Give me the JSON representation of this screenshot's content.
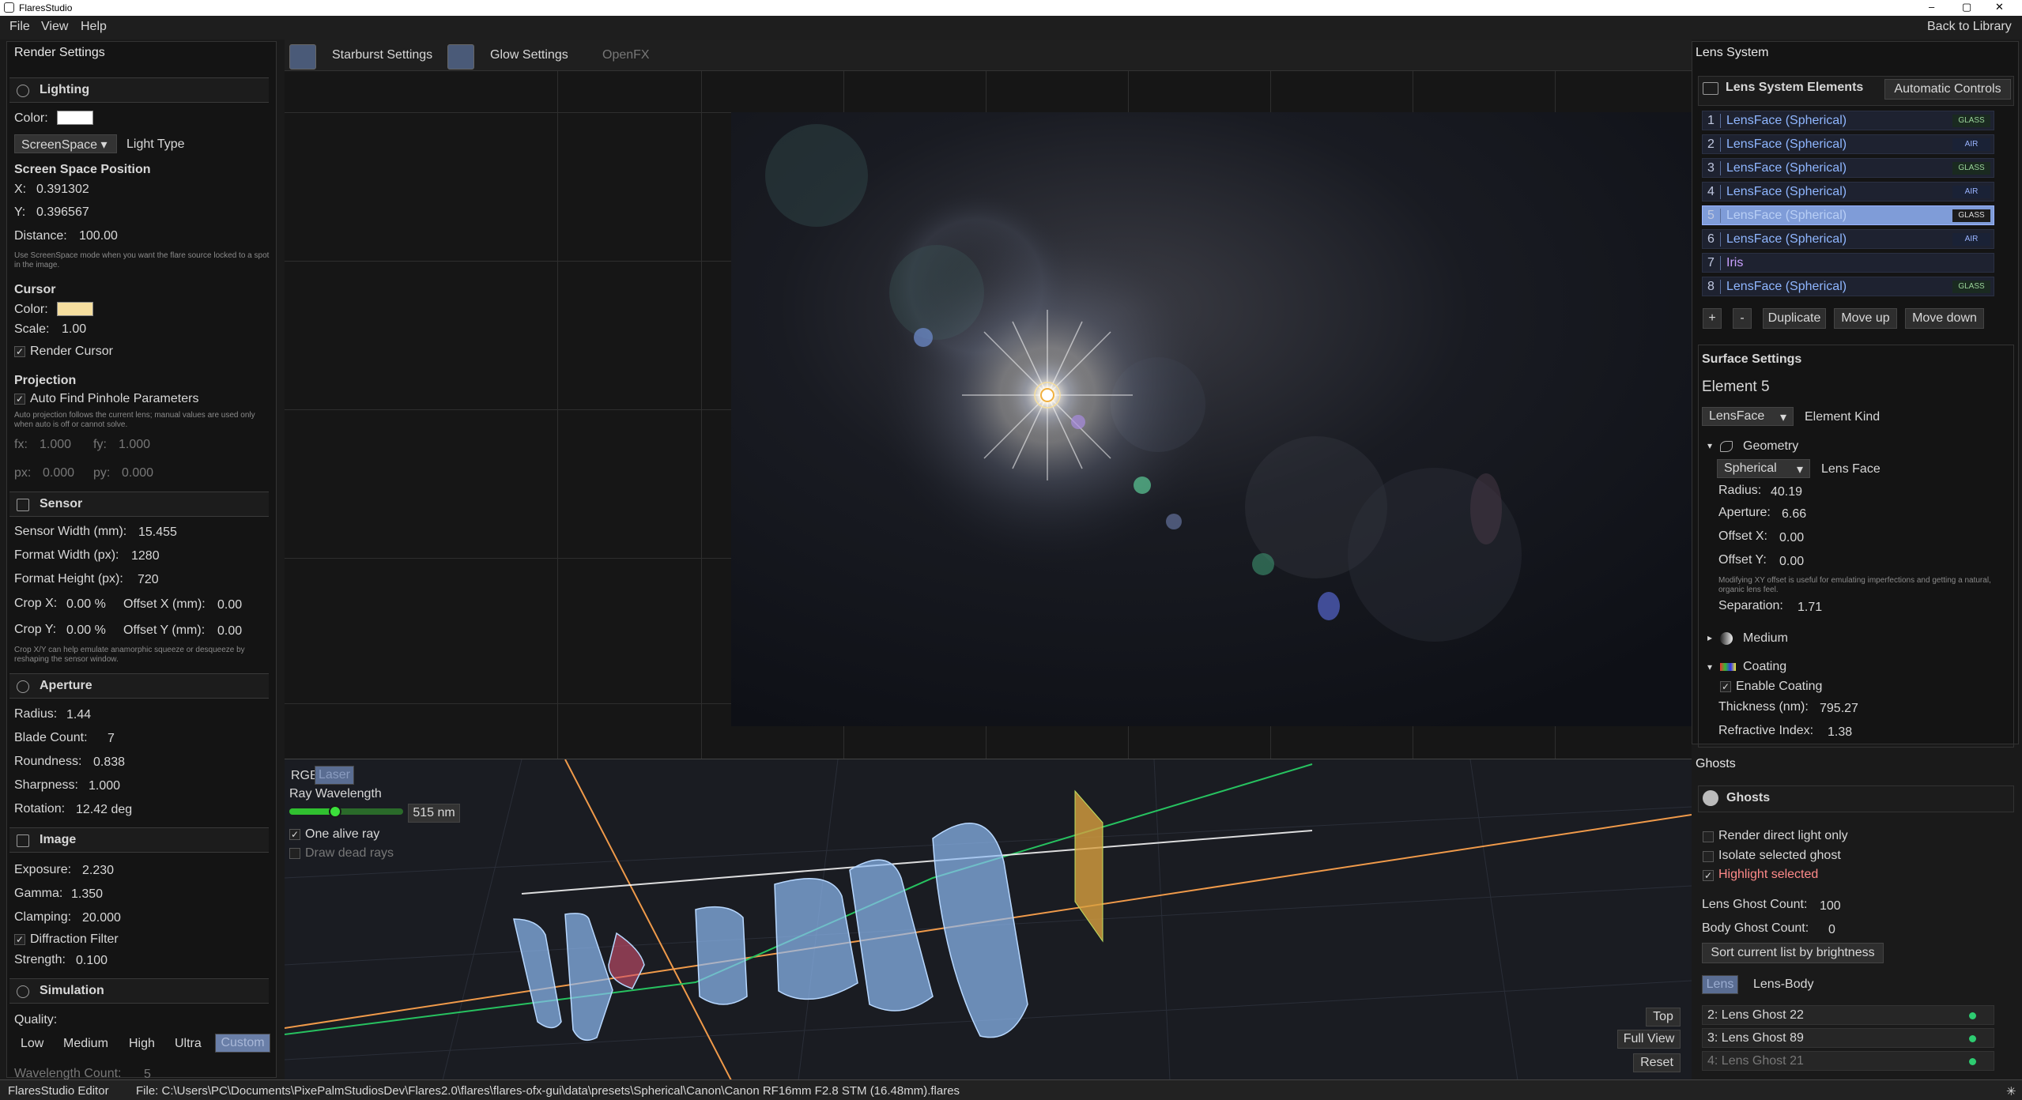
{
  "window": {
    "title": "FlaresStudio",
    "controls": [
      "–",
      "▢",
      "✕"
    ]
  },
  "menu": {
    "file": "File",
    "view": "View",
    "help": "Help",
    "back": "Back to Library"
  },
  "left": {
    "title": "Render Settings",
    "lighting": {
      "header": "Lighting",
      "color_label": "Color:",
      "light_type_value": "ScreenSpace",
      "light_type_label": "Light Type",
      "ssp_label": "Screen Space Position",
      "x_label": "X:",
      "x_value": "0.391302",
      "y_label": "Y:",
      "y_value": "0.396567",
      "distance_label": "Distance:",
      "distance_value": "100.00",
      "help": "Use ScreenSpace mode when you want the flare source locked to a spot in the image."
    },
    "cursor": {
      "header": "Cursor",
      "color_label": "Color:",
      "scale_label": "Scale:",
      "scale_value": "1.00",
      "render_label": "Render Cursor"
    },
    "projection": {
      "header": "Projection",
      "auto_label": "Auto Find Pinhole Parameters",
      "help": "Auto projection follows the current lens; manual values are used only when auto is off or cannot solve.",
      "fx_label": "fx:",
      "fx_value": "1.000",
      "fy_label": "fy:",
      "fy_value": "1.000",
      "px_label": "px:",
      "px_value": "0.000",
      "py_label": "py:",
      "py_value": "0.000"
    },
    "sensor": {
      "header": "Sensor",
      "width_label": "Sensor Width (mm):",
      "width_value": "15.455",
      "fw_label": "Format Width (px):",
      "fw_value": "1280",
      "fh_label": "Format Height (px):",
      "fh_value": "720",
      "cropx_label": "Crop X:",
      "cropx_value": "0.00 %",
      "offx_label": "Offset X (mm):",
      "offx_value": "0.00",
      "cropy_label": "Crop Y:",
      "cropy_value": "0.00 %",
      "offy_label": "Offset Y (mm):",
      "offy_value": "0.00",
      "help": "Crop X/Y can help emulate anamorphic squeeze or desqueeze by reshaping the sensor window."
    },
    "aperture": {
      "header": "Aperture",
      "radius_label": "Radius:",
      "radius_value": "1.44",
      "blade_label": "Blade Count:",
      "blade_value": "7",
      "round_label": "Roundness:",
      "round_value": "0.838",
      "sharp_label": "Sharpness:",
      "sharp_value": "1.000",
      "rot_label": "Rotation:",
      "rot_value": "12.42 deg"
    },
    "image": {
      "header": "Image",
      "exposure_label": "Exposure:",
      "exposure_value": "2.230",
      "gamma_label": "Gamma:",
      "gamma_value": "1.350",
      "clamp_label": "Clamping:",
      "clamp_value": "20.000",
      "diff_label": "Diffraction Filter",
      "strength_label": "Strength:",
      "strength_value": "0.100"
    },
    "simulation": {
      "header": "Simulation",
      "quality_label": "Quality:",
      "q": [
        "Low",
        "Medium",
        "High",
        "Ultra",
        "Custom"
      ],
      "wl_label": "Wavelength Count:",
      "wl_value": "5"
    }
  },
  "tabs": {
    "starburst": "Starburst Settings",
    "glow": "Glow Settings",
    "openfx": "OpenFX"
  },
  "raypanel": {
    "rgb": "RGB",
    "laser": "Laser",
    "wavelength_label": "Ray Wavelength",
    "wavelength_value": "515 nm",
    "wavelength_fraction": 0.4,
    "one_alive": "One alive ray",
    "dead_rays": "Draw dead rays",
    "top": "Top",
    "full_view": "Full View",
    "reset": "Reset"
  },
  "lens": {
    "title": "Lens System",
    "elements_header": "Lens System Elements",
    "auto_controls": "Automatic Controls",
    "elements": [
      {
        "n": "1",
        "name": "LensFace (Spherical)",
        "tag": "GLASS"
      },
      {
        "n": "2",
        "name": "LensFace (Spherical)",
        "tag": "AIR"
      },
      {
        "n": "3",
        "name": "LensFace (Spherical)",
        "tag": "GLASS"
      },
      {
        "n": "4",
        "name": "LensFace (Spherical)",
        "tag": "AIR"
      },
      {
        "n": "5",
        "name": "LensFace (Spherical)",
        "tag": "GLASS"
      },
      {
        "n": "6",
        "name": "LensFace (Spherical)",
        "tag": "AIR"
      },
      {
        "n": "7",
        "name": "Iris",
        "tag": ""
      },
      {
        "n": "8",
        "name": "LensFace (Spherical)",
        "tag": "GLASS"
      }
    ],
    "btn_add": "+",
    "btn_remove": "-",
    "btn_duplicate": "Duplicate",
    "btn_up": "Move up",
    "btn_down": "Move down",
    "surface_header": "Surface Settings",
    "element_title": "Element 5",
    "kind_value": "LensFace",
    "kind_label": "Element Kind",
    "geometry": "Geometry",
    "face_value": "Spherical",
    "face_label": "Lens Face",
    "radius_label": "Radius:",
    "radius_value": "40.19",
    "aperture_label": "Aperture:",
    "aperture_value": "6.66",
    "offx_label": "Offset X:",
    "offx_value": "0.00",
    "offy_label": "Offset Y:",
    "offy_value": "0.00",
    "offset_help": "Modifying XY offset is useful for emulating imperfections and getting a natural, organic lens feel.",
    "sep_label": "Separation:",
    "sep_value": "1.71",
    "medium": "Medium",
    "coating": "Coating",
    "enable_coating": "Enable Coating",
    "thick_label": "Thickness (nm):",
    "thick_value": "795.27",
    "ri_label": "Refractive Index:",
    "ri_value": "1.38"
  },
  "ghosts": {
    "title": "Ghosts",
    "header": "Ghosts",
    "direct": "Render direct light only",
    "isolate": "Isolate selected ghost",
    "highlight": "Highlight selected",
    "lens_count_label": "Lens Ghost Count:",
    "lens_count_value": "100",
    "body_count_label": "Body Ghost Count:",
    "body_count_value": "0",
    "sort": "Sort current list by brightness",
    "tab_lens": "Lens",
    "tab_body": "Lens-Body",
    "list": [
      "2: Lens Ghost 22",
      "3: Lens Ghost 89",
      "4: Lens Ghost 21"
    ]
  },
  "status": {
    "app": "FlaresStudio Editor",
    "file": "File: C:\\Users\\PC\\Documents\\PixePalmStudiosDev\\Flares2.0\\flares\\flares-ofx-gui\\data\\presets\\Spherical\\Canon\\Canon RF16mm F2.8 STM (16.48mm).flares"
  },
  "colors": {
    "accent": "#8fb6ff",
    "selected": "#7f9cd8",
    "ghost_dot": "#2ecc71",
    "highlight": "#ff8a8a"
  }
}
